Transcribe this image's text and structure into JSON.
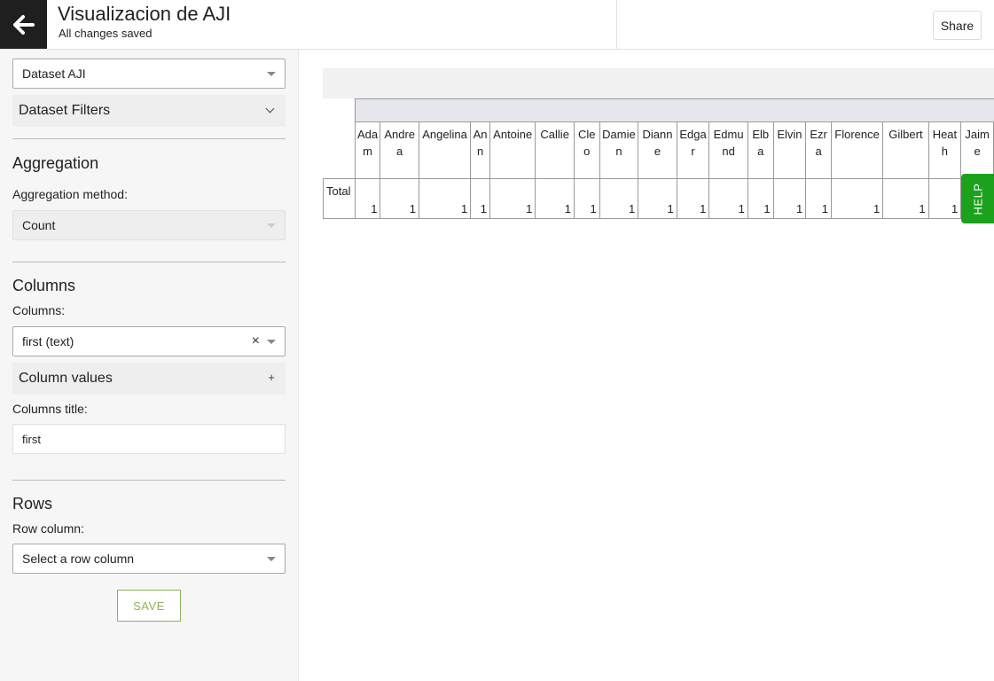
{
  "header": {
    "title": "Visualizacion de AJI",
    "subtitle": "All changes saved",
    "share_label": "Share"
  },
  "sidebar": {
    "dataset_select": "Dataset AJI",
    "dataset_filters_label": "Dataset Filters",
    "aggregation": {
      "title": "Aggregation",
      "method_label": "Aggregation method:",
      "method_value": "Count"
    },
    "columns": {
      "title": "Columns",
      "columns_label": "Columns:",
      "columns_value": "first (text)",
      "clear_symbol": "×",
      "column_values_label": "Column values",
      "column_values_toggle": "+",
      "columns_title_label": "Columns title:",
      "columns_title_value": "first"
    },
    "rows": {
      "title": "Rows",
      "row_column_label": "Row column:",
      "row_column_placeholder": "Select a row column"
    },
    "save_label": "SAVE"
  },
  "pivot": {
    "row_label": "Total",
    "columns": [
      {
        "name": "Adam",
        "value": "1"
      },
      {
        "name": "Andrea",
        "value": "1"
      },
      {
        "name": "Angelina",
        "value": "1"
      },
      {
        "name": "Ann",
        "value": "1"
      },
      {
        "name": "Antoine",
        "value": "1"
      },
      {
        "name": "Callie",
        "value": "1"
      },
      {
        "name": "Cleo",
        "value": "1"
      },
      {
        "name": "Damien",
        "value": "1"
      },
      {
        "name": "Dianne",
        "value": "1"
      },
      {
        "name": "Edgar",
        "value": "1"
      },
      {
        "name": "Edmund",
        "value": "1"
      },
      {
        "name": "Elba",
        "value": "1"
      },
      {
        "name": "Elvin",
        "value": "1"
      },
      {
        "name": "Ezra",
        "value": "1"
      },
      {
        "name": "Florence",
        "value": "1"
      },
      {
        "name": "Gilbert",
        "value": "1"
      },
      {
        "name": "Heath",
        "value": "1"
      },
      {
        "name": "Jaime",
        "value": "1"
      }
    ]
  },
  "help_label": "HELP"
}
